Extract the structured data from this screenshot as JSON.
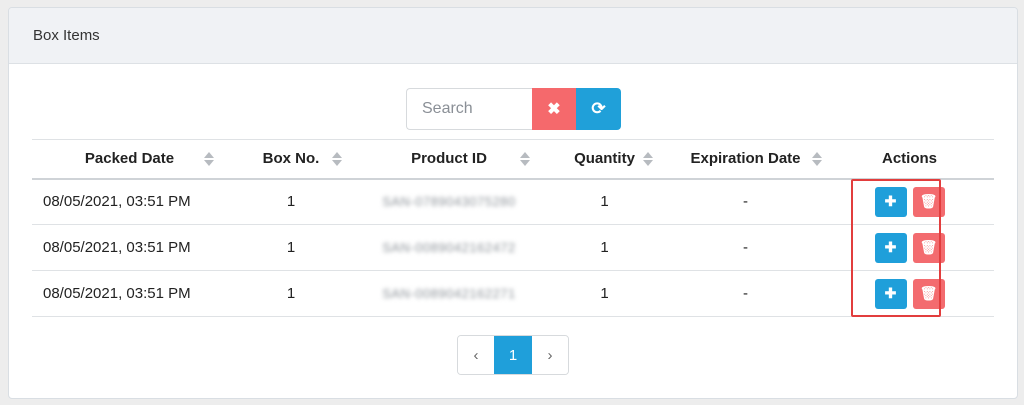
{
  "panel": {
    "title": "Box Items"
  },
  "search": {
    "placeholder": "Search"
  },
  "table": {
    "columns": [
      "Packed Date",
      "Box No.",
      "Product ID",
      "Quantity",
      "Expiration Date",
      "Actions"
    ],
    "rows": [
      {
        "packed_date": "08/05/2021, 03:51 PM",
        "box_no": "1",
        "product_id": "SAN-0789043075280",
        "quantity": "1",
        "expiration_date": "-"
      },
      {
        "packed_date": "08/05/2021, 03:51 PM",
        "box_no": "1",
        "product_id": "SAN-0089042162472",
        "quantity": "1",
        "expiration_date": "-"
      },
      {
        "packed_date": "08/05/2021, 03:51 PM",
        "box_no": "1",
        "product_id": "SAN-0089042162271",
        "quantity": "1",
        "expiration_date": "-"
      }
    ]
  },
  "pagination": {
    "prev": "‹",
    "current": "1",
    "next": "›"
  },
  "colors": {
    "primary": "#1f9fda",
    "danger": "#f36b6f",
    "highlight": "#e23d3d"
  }
}
